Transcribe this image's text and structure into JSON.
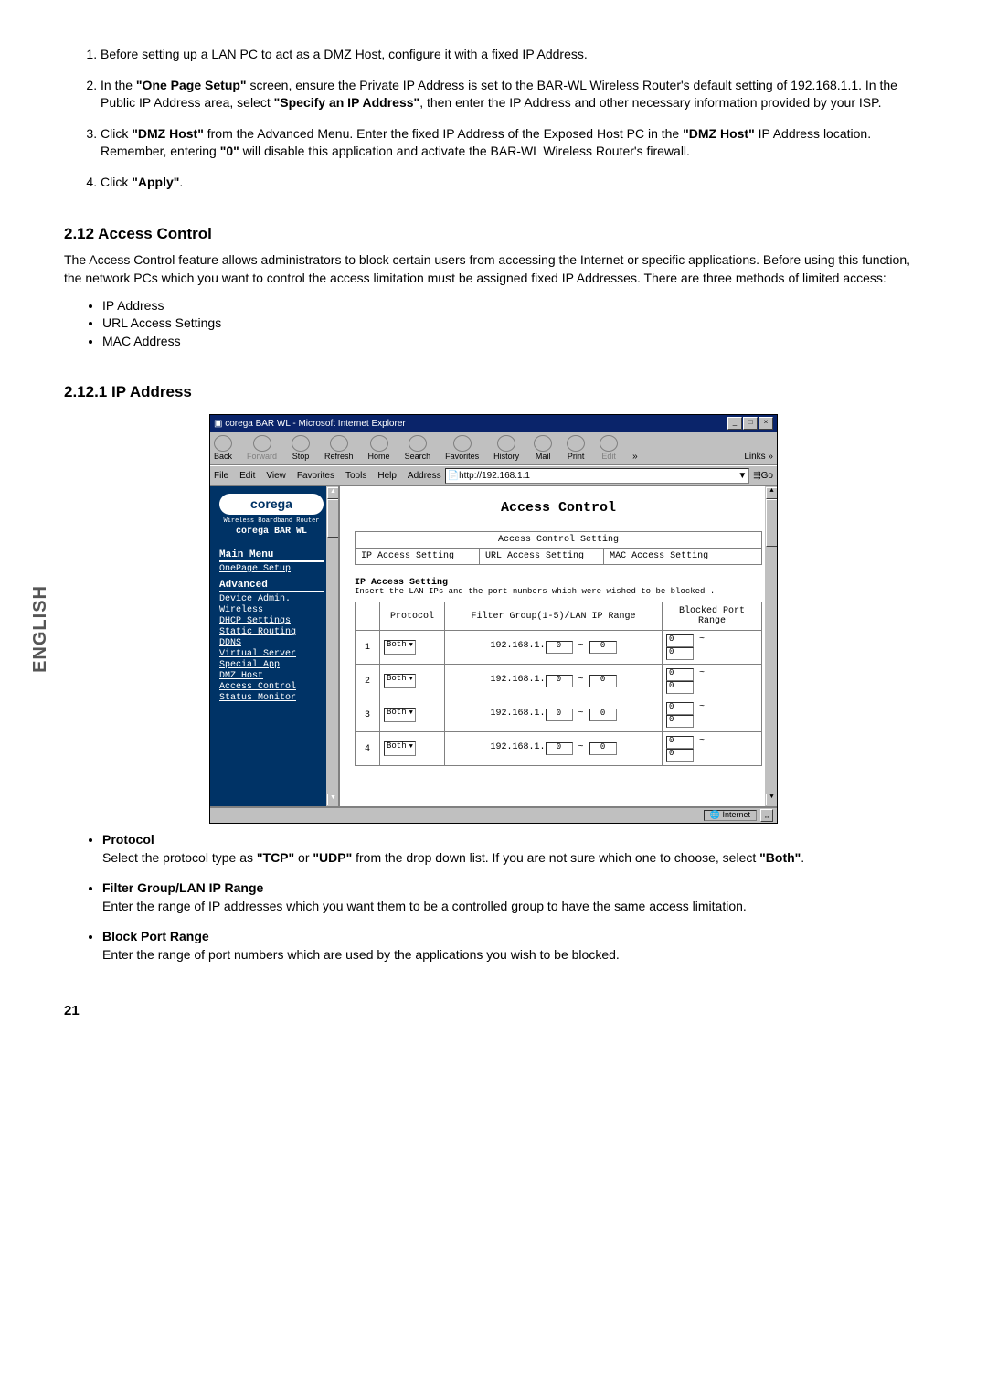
{
  "instr": {
    "items": [
      "Before setting up a LAN PC to act as a DMZ Host, configure it with a fixed IP Address.",
      "In the <b>\"One Page Setup\"</b> screen, ensure the Private IP Address is set to the BAR-WL Wireless Router's default setting of 192.168.1.1. In the Public IP Address area, select <b>\"Specify an IP Address\"</b>, then enter the IP Address and other necessary information provided by your ISP.",
      "Click <b>\"DMZ Host\"</b> from the Advanced Menu. Enter the fixed IP Address of the Exposed Host PC in the <b>\"DMZ Host\"</b> IP Address location. Remember, entering <b>\"0\"</b> will disable this application and activate the BAR-WL Wireless Router's firewall.",
      "Click <b>\"Apply\"</b>."
    ]
  },
  "section212": {
    "heading": "2.12 Access Control",
    "para": "The Access Control feature allows administrators to block certain users from accessing the Internet or specific applications. Before using this function, the network PCs which you want to control the access limitation must be assigned fixed IP Addresses. There are three methods of limited access:",
    "bullets": [
      "IP Address",
      "URL Access Settings",
      "MAC Address"
    ]
  },
  "section2121": {
    "heading": "2.12.1 IP Address"
  },
  "side_tab": "ENGLISH",
  "win": {
    "title": "corega BAR WL - Microsoft Internet Explorer",
    "toolbar": [
      "Back",
      "Forward",
      "Stop",
      "Refresh",
      "Home",
      "Search",
      "Favorites",
      "History",
      "Mail",
      "Print",
      "Edit"
    ],
    "toolbar_disabled": [
      false,
      true,
      false,
      false,
      false,
      false,
      false,
      false,
      false,
      false,
      true
    ],
    "links_label": "Links",
    "menubar": [
      "File",
      "Edit",
      "View",
      "Favorites",
      "Tools",
      "Help"
    ],
    "address_label": "Address",
    "address_value": "http://192.168.1.1",
    "go_label": "Go",
    "sidebar": {
      "logo": "corega",
      "sub": "Wireless Boardband Router",
      "product": "corega  BAR WL",
      "main_head": "Main Menu",
      "main_links": [
        "OnePage Setup"
      ],
      "adv_head": "Advanced",
      "adv_links": [
        "Device Admin.",
        "Wireless",
        "DHCP Settings",
        "Static Routing",
        "DDNS",
        "Virtual Server",
        "Special App",
        "DMZ Host",
        "Access Control",
        "Status Monitor"
      ]
    },
    "main": {
      "title": "Access Control",
      "subtitle": "Access Control Setting",
      "tabs": [
        "IP Access Setting",
        "URL Access Setting",
        "MAC Access Setting"
      ],
      "sett_head": "IP Access Setting",
      "sett_note": "Insert the LAN IPs and the port numbers which were wished to be blocked .",
      "cols": [
        "",
        "Protocol",
        "Filter Group(1-5)/LAN IP Range",
        "Blocked Port Range"
      ],
      "rows": [
        {
          "n": "1",
          "proto": "Both",
          "netprefix": "192.168.1.",
          "a": "0",
          "b": "0",
          "p1": "0",
          "p2": "0"
        },
        {
          "n": "2",
          "proto": "Both",
          "netprefix": "192.168.1.",
          "a": "0",
          "b": "0",
          "p1": "0",
          "p2": "0"
        },
        {
          "n": "3",
          "proto": "Both",
          "netprefix": "192.168.1.",
          "a": "0",
          "b": "0",
          "p1": "0",
          "p2": "0"
        },
        {
          "n": "4",
          "proto": "Both",
          "netprefix": "192.168.1.",
          "a": "0",
          "b": "0",
          "p1": "0",
          "p2": "0"
        }
      ]
    },
    "status_zone": "Internet"
  },
  "desc": [
    {
      "term": "Protocol",
      "text": "Select the protocol type as <b>\"TCP\"</b> or <b>\"UDP\"</b> from the drop down list. If you are not sure which one to choose, select <b>\"Both\"</b>."
    },
    {
      "term": "Filter Group/LAN IP Range",
      "text": "Enter the range of IP addresses which you want them to be a controlled group to have the same access limitation."
    },
    {
      "term": "Block Port Range",
      "text": "Enter the range of port numbers which are used by the applications you wish to be blocked."
    }
  ],
  "page_num": "21"
}
